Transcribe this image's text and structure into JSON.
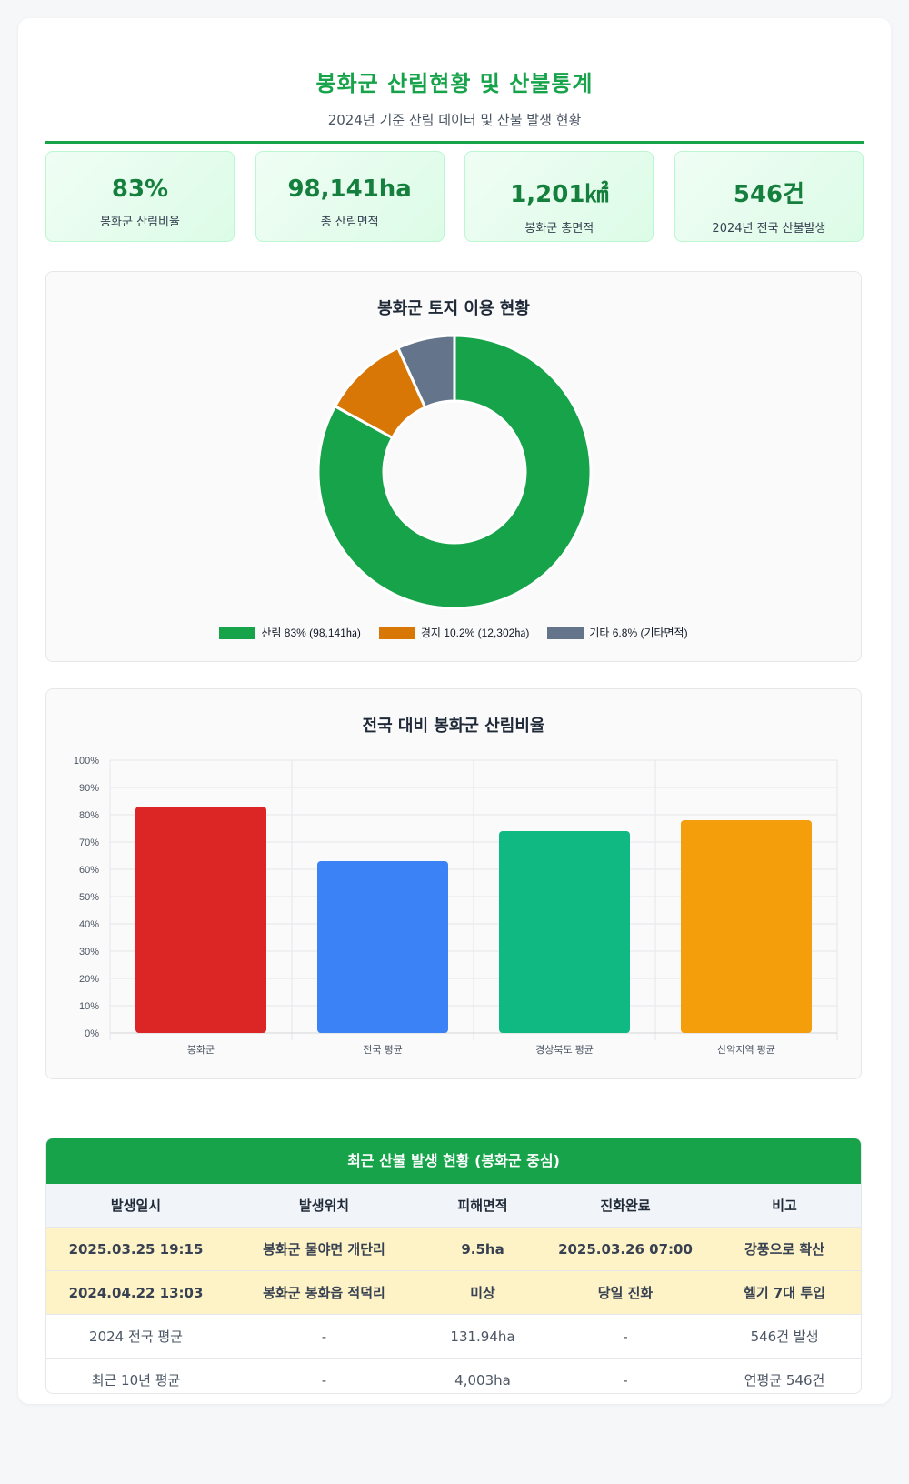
{
  "header": {
    "title": "봉화군 산림현황 및 산불통계",
    "subtitle": "2024년 기준 산림 데이터 및 산불 발생 현황"
  },
  "stats": [
    {
      "value": "83%",
      "label": "봉화군 산림비율"
    },
    {
      "value": "98,141ha",
      "label": "총 산림면적"
    },
    {
      "value": "1,201㎢",
      "label": "봉화군 총면적"
    },
    {
      "value": "546건",
      "label": "2024년 전국 산불발생"
    }
  ],
  "colors": {
    "accent": "#16a34a"
  },
  "chart_data": [
    {
      "type": "pie",
      "title": "봉화군 토지 이용 현황",
      "categories": [
        "산림 83% (98,141㏊)",
        "경지 10.2% (12,302㏊)",
        "기타 6.8% (기타면적)"
      ],
      "values": [
        83,
        10.2,
        6.8
      ],
      "colors": [
        "#16a34a",
        "#d97706",
        "#64748b"
      ],
      "legend": "bottom"
    },
    {
      "type": "bar",
      "title": "전국 대비 봉화군 산림비율",
      "categories": [
        "봉화군",
        "전국 평균",
        "경상북도 평균",
        "산악지역 평균"
      ],
      "values": [
        83,
        63,
        74,
        78
      ],
      "colors": [
        "#dc2626",
        "#3b82f6",
        "#10b981",
        "#f59e0b"
      ],
      "ylim": [
        0,
        100
      ],
      "yticks": [
        "0%",
        "10%",
        "20%",
        "30%",
        "40%",
        "50%",
        "60%",
        "70%",
        "80%",
        "90%",
        "100%"
      ],
      "grid": true
    }
  ],
  "table": {
    "title": "최근 산불 발생 현황 (봉화군 중심)",
    "headers": [
      "발생일시",
      "발생위치",
      "피해면적",
      "진화완료",
      "비고"
    ],
    "rows": [
      [
        "2025.03.25 19:15",
        "봉화군 물야면 개단리",
        "9.5ha",
        "2025.03.26 07:00",
        "강풍으로 확산"
      ],
      [
        "2024.04.22 13:03",
        "봉화군 봉화읍 적덕리",
        "미상",
        "당일 진화",
        "헬기 7대 투입"
      ],
      [
        "2024 전국 평균",
        "-",
        "131.94ha",
        "-",
        "546건 발생"
      ],
      [
        "최근 10년 평균",
        "-",
        "4,003ha",
        "-",
        "연평균 546건"
      ]
    ],
    "highlight_rows": [
      0,
      1
    ]
  }
}
